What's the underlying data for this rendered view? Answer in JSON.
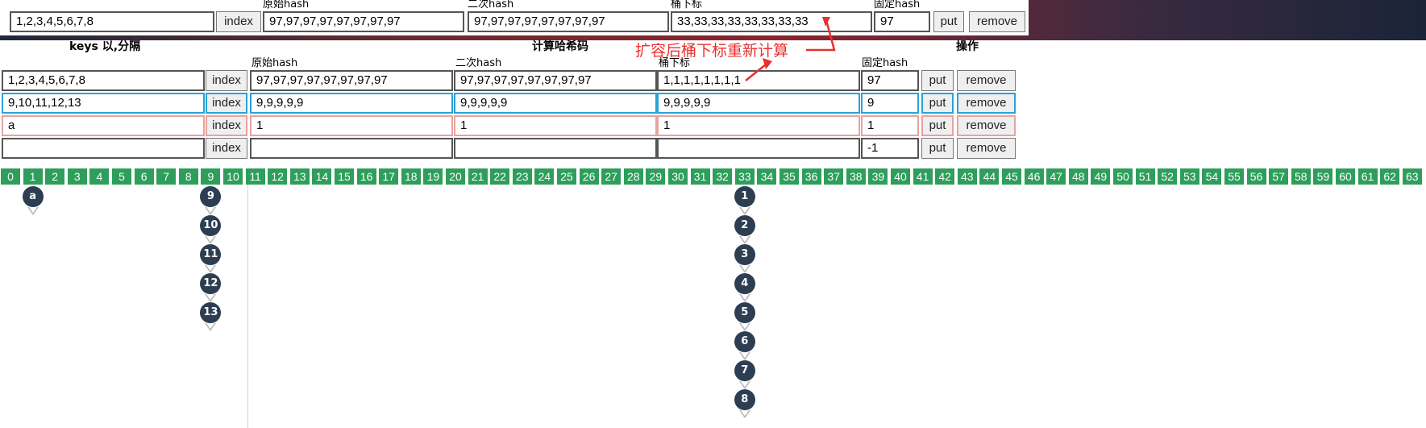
{
  "top_row": {
    "headers": {
      "orig_hash": "原始hash",
      "second_hash": "二次hash",
      "bucket_index": "桶下标",
      "fixed_hash": "固定hash"
    },
    "keys": "1,2,3,4,5,6,7,8",
    "orig_hash": "97,97,97,97,97,97,97,97",
    "second_hash": "97,97,97,97,97,97,97,97",
    "bucket_index": "33,33,33,33,33,33,33,33",
    "fixed_hash": "97",
    "index_label": "index",
    "put_label": "put",
    "remove_label": "remove"
  },
  "groups": {
    "keys": "keys 以,分隔",
    "compute": "计算哈希码",
    "ops": "操作"
  },
  "col_headers": {
    "orig_hash": "原始hash",
    "second_hash": "二次hash",
    "bucket_index": "桶下标",
    "fixed_hash": "固定hash"
  },
  "annotation": "扩容后桶下标重新计算",
  "rows": [
    {
      "keys": "1,2,3,4,5,6,7,8",
      "orig_hash": "97,97,97,97,97,97,97,97",
      "second_hash": "97,97,97,97,97,97,97,97",
      "bucket_index": "1,1,1,1,1,1,1,1",
      "fixed_hash": "97",
      "index_label": "index",
      "put_label": "put",
      "remove_label": "remove"
    },
    {
      "keys": "9,10,11,12,13",
      "orig_hash": "9,9,9,9,9",
      "second_hash": "9,9,9,9,9",
      "bucket_index": "9,9,9,9,9",
      "fixed_hash": "9",
      "index_label": "index",
      "put_label": "put",
      "remove_label": "remove"
    },
    {
      "keys": "a",
      "orig_hash": "1",
      "second_hash": "1",
      "bucket_index": "1",
      "fixed_hash": "1",
      "index_label": "index",
      "put_label": "put",
      "remove_label": "remove"
    },
    {
      "keys": "",
      "orig_hash": "",
      "second_hash": "",
      "bucket_index": "",
      "fixed_hash": "-1",
      "index_label": "index",
      "put_label": "put",
      "remove_label": "remove"
    }
  ],
  "buckets": [
    "0",
    "1",
    "2",
    "3",
    "4",
    "5",
    "6",
    "7",
    "8",
    "9",
    "10",
    "11",
    "12",
    "13",
    "14",
    "15",
    "16",
    "17",
    "18",
    "19",
    "20",
    "21",
    "22",
    "23",
    "24",
    "25",
    "26",
    "27",
    "28",
    "29",
    "30",
    "31",
    "32",
    "33",
    "34",
    "35",
    "36",
    "37",
    "38",
    "39",
    "40",
    "41",
    "42",
    "43",
    "44",
    "45",
    "46",
    "47",
    "48",
    "49",
    "50",
    "51",
    "52",
    "53",
    "54",
    "55",
    "56",
    "57",
    "58",
    "59",
    "60",
    "61",
    "62",
    "63"
  ],
  "chains": [
    {
      "bucket": "1",
      "nodes": [
        "a"
      ]
    },
    {
      "bucket": "9",
      "nodes": [
        "9",
        "10",
        "11",
        "12",
        "13"
      ]
    },
    {
      "bucket": "33",
      "nodes": [
        "1",
        "2",
        "3",
        "4",
        "5",
        "6",
        "7",
        "8"
      ]
    }
  ],
  "colors": {
    "bucket_green": "#2e9e5b",
    "node_dark": "#2d3e52",
    "annotation_red": "#e83030",
    "highlight_blue": "#2aa3d6",
    "highlight_red": "#e8a2a0"
  }
}
